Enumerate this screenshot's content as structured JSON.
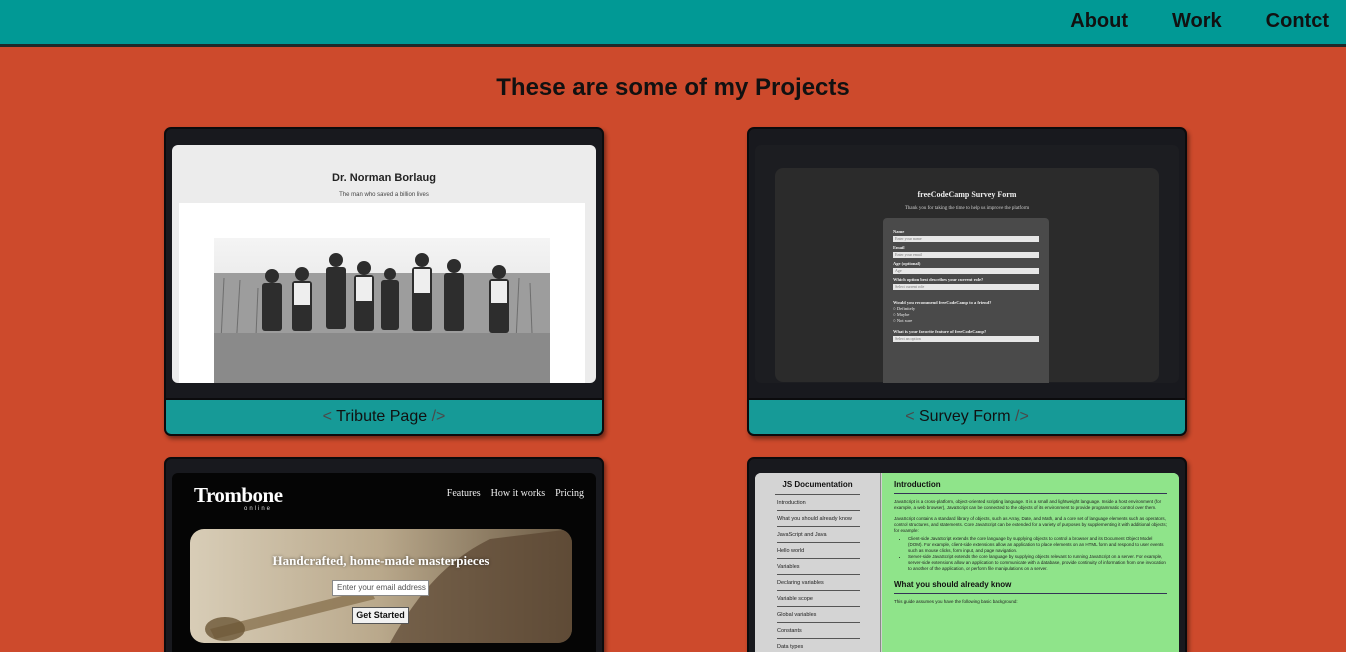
{
  "nav": {
    "links": [
      "About",
      "Work",
      "Contct"
    ]
  },
  "projects": {
    "title": "These are some of my Projects",
    "items": [
      {
        "open_bracket": "<",
        "name": "Tribute Page",
        "close_bracket": "/>",
        "preview": {
          "title": "Dr. Norman Borlaug",
          "subtitle": "The man who saved a billion lives"
        }
      },
      {
        "open_bracket": "<",
        "name": "Survey Form",
        "close_bracket": "/>",
        "preview": {
          "title": "freeCodeCamp Survey Form",
          "subtitle": "Thank you for taking the time to help us improve the platform",
          "fields": [
            {
              "label": "Name",
              "placeholder": "Enter your name"
            },
            {
              "label": "Email",
              "placeholder": "Enter your email"
            },
            {
              "label": "Age (optional)",
              "placeholder": "Age"
            }
          ],
          "role_question": "Which option best describes your current role?",
          "role_select": "Select current role",
          "recommend_question": "Would you recommend freeCodeCamp to a friend?",
          "recommend_options": [
            "Definitely",
            "Maybe",
            "Not sure"
          ],
          "feature_question": "What is your favorite feature of freeCodeCamp?",
          "feature_select": "Select an option"
        }
      },
      {
        "preview": {
          "logo": "Trombone",
          "logo_sub": "online",
          "nav": [
            "Features",
            "How it works",
            "Pricing"
          ],
          "hero_title": "Handcrafted, home-made masterpieces",
          "email_placeholder": "Enter your email address",
          "button": "Get Started"
        }
      },
      {
        "preview": {
          "side_title": "JS Documentation",
          "side_items": [
            "Introduction",
            "What you should already know",
            "JavaScript and Java",
            "Hello world",
            "Variables",
            "Declaring variables",
            "Variable scope",
            "Global variables",
            "Constants",
            "Data types"
          ],
          "heading1": "Introduction",
          "para1": "JavaScript is a cross-platform, object-oriented scripting language. It is a small and lightweight language. Inside a host environment (for example, a web browser), JavaScript can be connected to the objects of its environment to provide programmatic control over them.",
          "para2": "JavaScript contains a standard library of objects, such as Array, Date, and Math, and a core set of language elements such as operators, control structures, and statements. Core JavaScript can be extended for a variety of purposes by supplementing it with additional objects; for example:",
          "bullet1": "Client-side JavaScript extends the core language by supplying objects to control a browser and its Document Object Model (DOM). For example, client-side extensions allow an application to place elements on an HTML form and respond to user events such as mouse clicks, form input, and page navigation.",
          "bullet2": "Server-side JavaScript extends the core language by supplying objects relevant to running JavaScript on a server. For example, server-side extensions allow an application to communicate with a database, provide continuity of information from one invocation to another of the application, or perform file manipulations on a server.",
          "heading2": "What you should already know",
          "para3": "This guide assumes you have the following basic background:"
        }
      }
    ]
  }
}
